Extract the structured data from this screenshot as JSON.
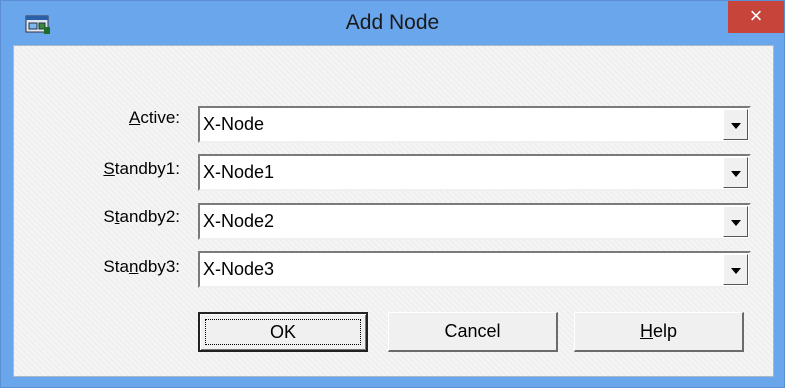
{
  "window": {
    "title": "Add Node",
    "close_glyph": "×"
  },
  "form": {
    "rows": [
      {
        "label_hotkey": "A",
        "label_rest": "ctive:",
        "label_prefix": "",
        "value": "X-Node"
      },
      {
        "label_prefix": "",
        "label_hotkey": "S",
        "label_rest": "tandby1:",
        "value": "X-Node1"
      },
      {
        "label_prefix": "S",
        "label_hotkey": "t",
        "label_rest": "andby2:",
        "value": "X-Node2"
      },
      {
        "label_prefix": "Sta",
        "label_hotkey": "n",
        "label_rest": "dby3:",
        "value": "X-Node3"
      }
    ]
  },
  "buttons": {
    "ok": {
      "label": "OK"
    },
    "cancel": {
      "label": "Cancel"
    },
    "help": {
      "hotkey": "H",
      "rest": "elp"
    }
  },
  "colors": {
    "titlebar": "#6aa6ec",
    "close": "#c7443b",
    "client": "#f4f4f4"
  },
  "icons": {
    "app": "node-window-icon",
    "close": "close-icon",
    "dropdown": "chevron-down-icon"
  }
}
